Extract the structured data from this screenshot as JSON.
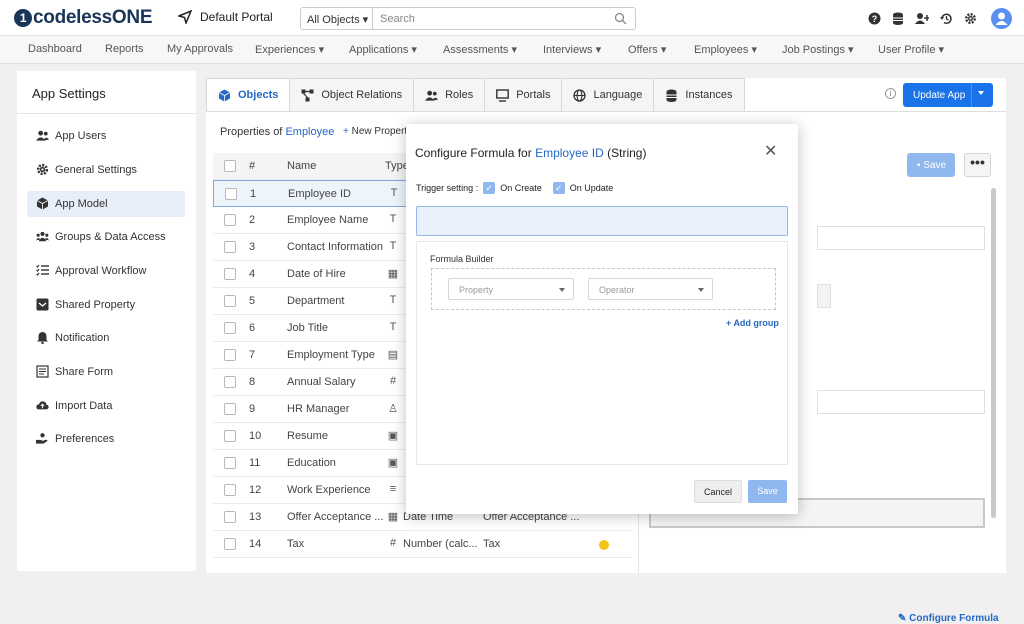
{
  "app": {
    "logo_text": "codelessONE",
    "logo_mark": "1",
    "portal_label": "Default Portal"
  },
  "search": {
    "scope": "All Objects",
    "placeholder": "Search"
  },
  "top_icons": [
    "help-icon",
    "database-icon",
    "add-user-icon",
    "history-icon",
    "settings-icon",
    "avatar"
  ],
  "nav": [
    "Dashboard",
    "Reports",
    "My Approvals",
    "Experiences",
    "Applications",
    "Assessments",
    "Interviews",
    "Offers",
    "Employees",
    "Job Postings",
    "User Profile"
  ],
  "sidebar": {
    "title": "App Settings",
    "items": [
      {
        "label": "App Users",
        "icon": "users-icon"
      },
      {
        "label": "General Settings",
        "icon": "gear-icon"
      },
      {
        "label": "App Model",
        "icon": "cube-icon"
      },
      {
        "label": "Groups & Data Access",
        "icon": "group-icon"
      },
      {
        "label": "Approval Workflow",
        "icon": "workflow-icon"
      },
      {
        "label": "Shared Property",
        "icon": "shared-icon"
      },
      {
        "label": "Notification",
        "icon": "bell-icon"
      },
      {
        "label": "Share Form",
        "icon": "form-icon"
      },
      {
        "label": "Import Data",
        "icon": "cloud-upload-icon"
      },
      {
        "label": "Preferences",
        "icon": "hand-icon"
      }
    ]
  },
  "tabs": [
    "Objects",
    "Object Relations",
    "Roles",
    "Portals",
    "Language",
    "Instances"
  ],
  "update_app_label": "Update App",
  "properties": {
    "prefix": "Properties of",
    "object": "Employee",
    "new_property": "New Property"
  },
  "table": {
    "headers": {
      "num": "#",
      "name": "Name",
      "type": "Type"
    },
    "rows": [
      {
        "n": "1",
        "name": "Employee ID",
        "type_icon": "T",
        "type": "",
        "calc": ""
      },
      {
        "n": "2",
        "name": "Employee Name",
        "type_icon": "T",
        "type": "",
        "calc": ""
      },
      {
        "n": "3",
        "name": "Contact Information",
        "type_icon": "T",
        "type": "",
        "calc": ""
      },
      {
        "n": "4",
        "name": "Date of Hire",
        "type_icon": "▦",
        "type": "",
        "calc": ""
      },
      {
        "n": "5",
        "name": "Department",
        "type_icon": "T",
        "type": "",
        "calc": ""
      },
      {
        "n": "6",
        "name": "Job Title",
        "type_icon": "T",
        "type": "",
        "calc": ""
      },
      {
        "n": "7",
        "name": "Employment Type",
        "type_icon": "▤",
        "type": "",
        "calc": ""
      },
      {
        "n": "8",
        "name": "Annual Salary",
        "type_icon": "#",
        "type": "",
        "calc": ""
      },
      {
        "n": "9",
        "name": "HR Manager",
        "type_icon": "♙",
        "type": "",
        "calc": ""
      },
      {
        "n": "10",
        "name": "Resume",
        "type_icon": "▣",
        "type": "",
        "calc": ""
      },
      {
        "n": "11",
        "name": "Education",
        "type_icon": "▣",
        "type": "",
        "calc": ""
      },
      {
        "n": "12",
        "name": "Work Experience",
        "type_icon": "≡",
        "type": "",
        "calc": ""
      },
      {
        "n": "13",
        "name": "Offer Acceptance ...",
        "type_icon": "▦",
        "type": "Date Time",
        "calc": "Offer Acceptance ..."
      },
      {
        "n": "14",
        "name": "Tax",
        "type_icon": "#",
        "type": "Number (calc...",
        "calc": "Tax"
      }
    ]
  },
  "right_panel": {
    "save_label": "Save",
    "more_label": "•••",
    "configure_formula_label": "Configure Formula"
  },
  "modal": {
    "title_prefix": "Configure Formula for",
    "property_name": "Employee ID",
    "property_type": "(String)",
    "trigger_label": "Trigger setting :",
    "on_create": "On Create",
    "on_update": "On Update",
    "formula_builder": "Formula Builder",
    "property_placeholder": "Property",
    "operator_placeholder": "Operator",
    "add_group": "Add group",
    "cancel": "Cancel",
    "save": "Save"
  },
  "colors": {
    "accent": "#1a73e8",
    "link": "#2668c5",
    "disabled_button": "#8fb8ee",
    "dot": "#f0c419"
  }
}
